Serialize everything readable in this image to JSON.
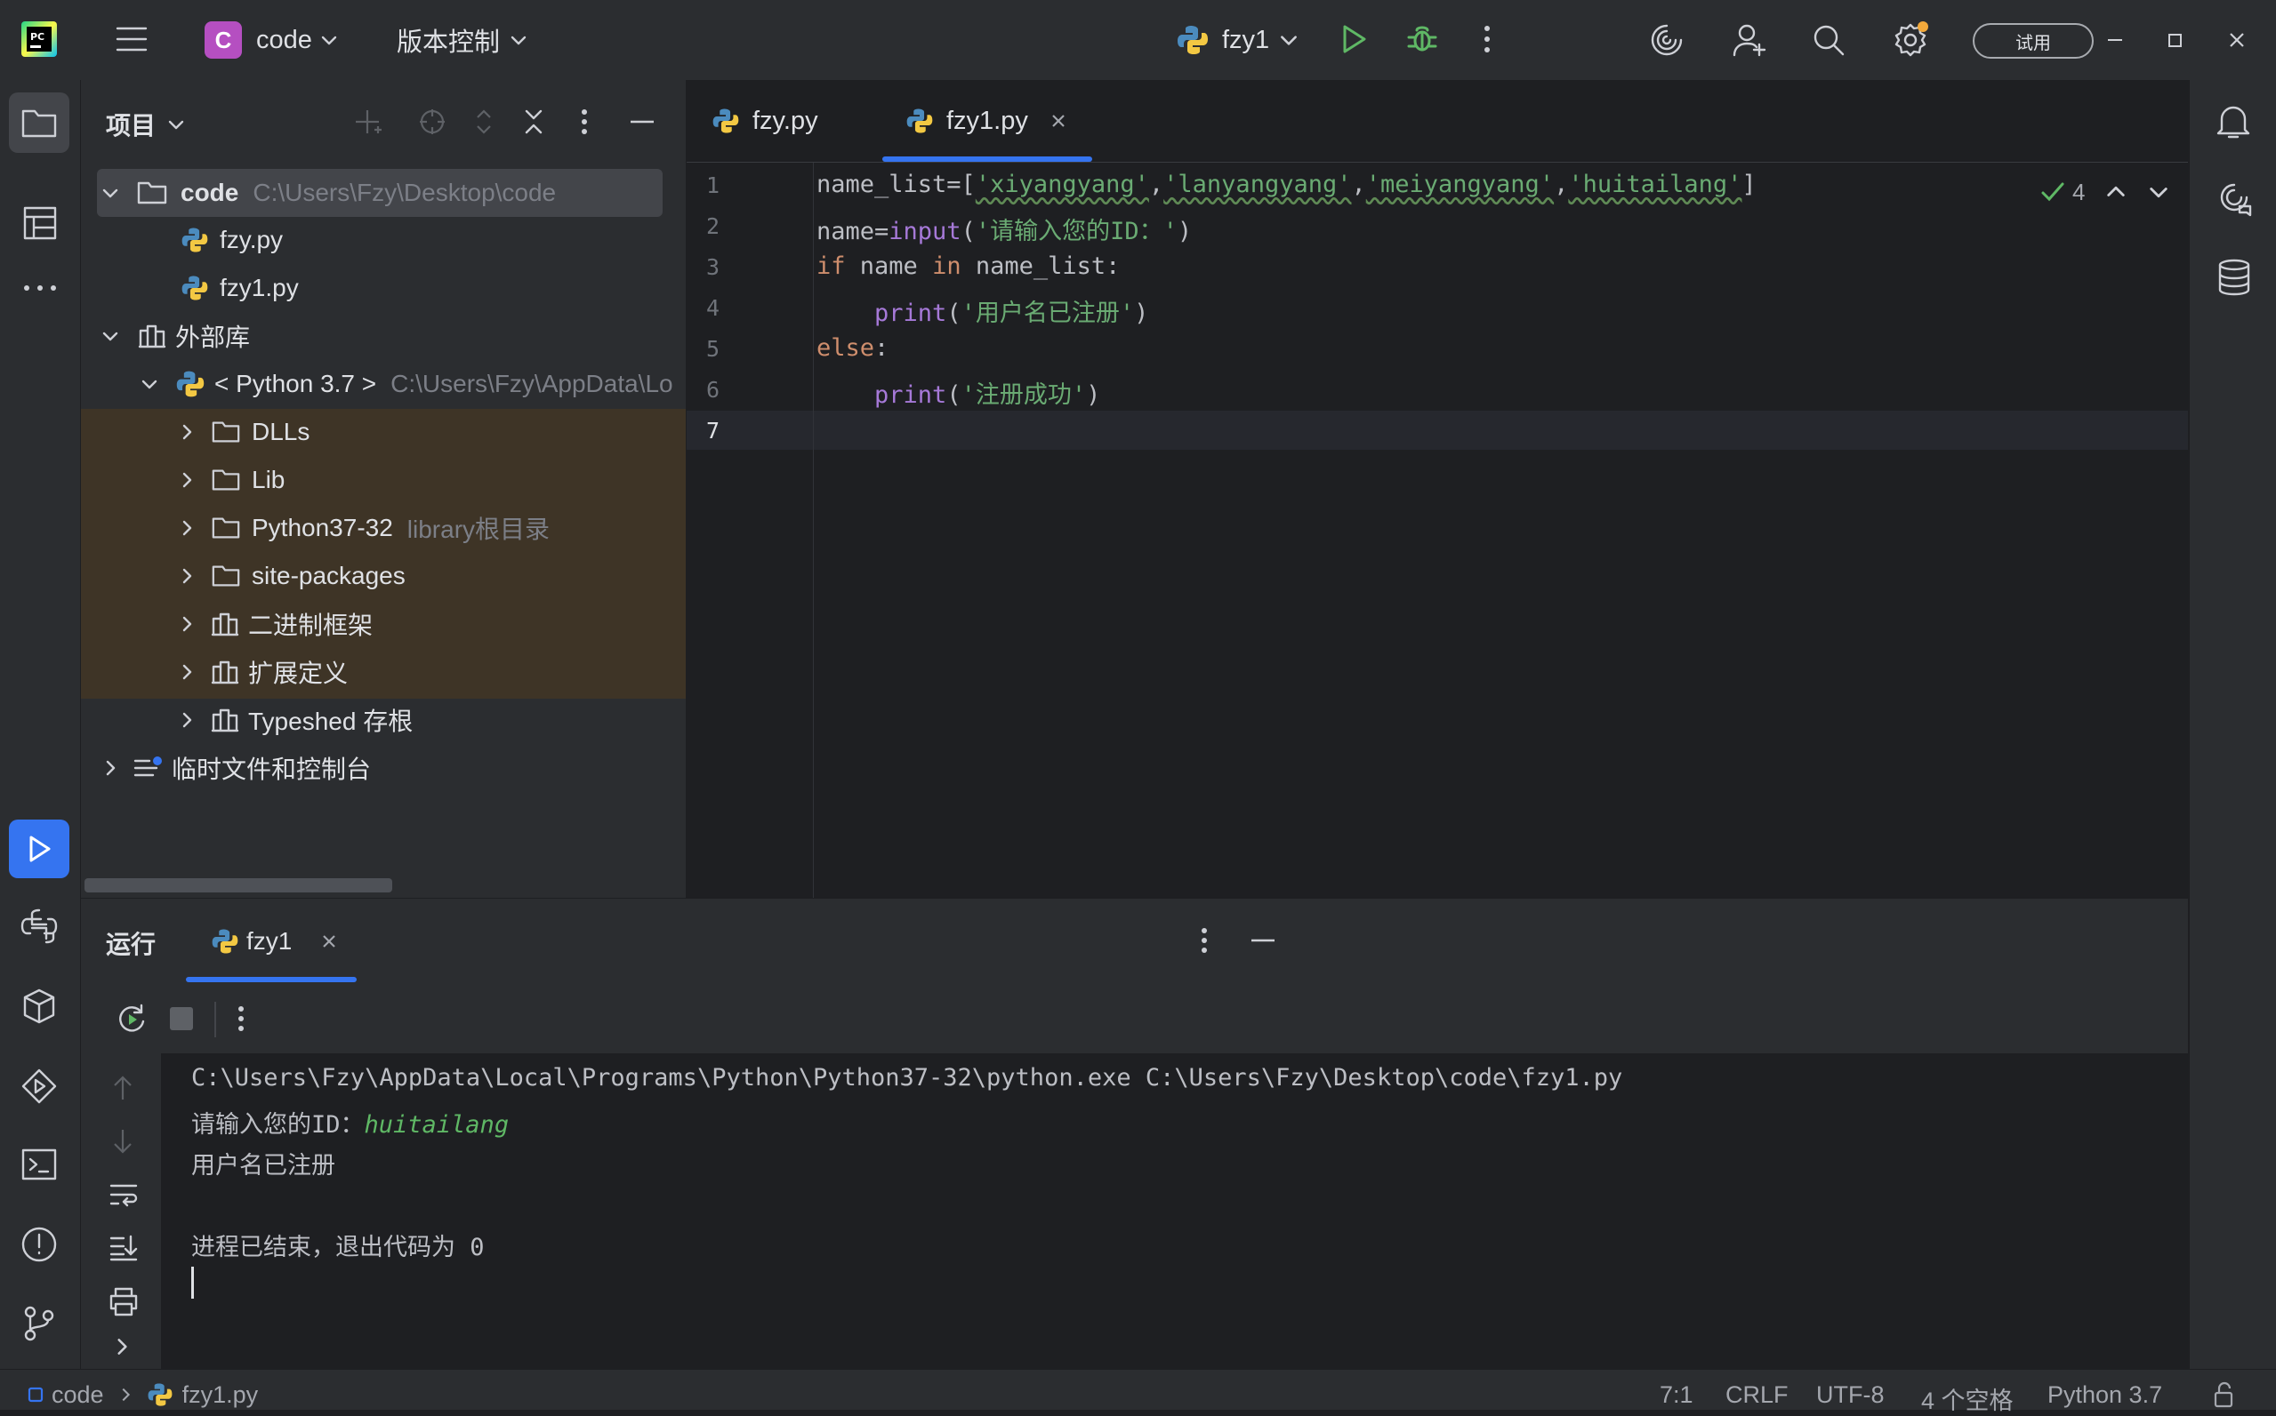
{
  "titlebar": {
    "project_letter": "C",
    "project_name": "code",
    "vcs_label": "版本控制",
    "run_config": "fzy1",
    "trial_label": "试用"
  },
  "project_panel": {
    "title": "项目",
    "root": {
      "name": "code",
      "path": "C:\\Users\\Fzy\\Desktop\\code"
    },
    "files": [
      "fzy.py",
      "fzy1.py"
    ],
    "external_libs": "外部库",
    "python_sdk": {
      "name": "< Python 3.7 >",
      "path": "C:\\Users\\Fzy\\AppData\\Lo"
    },
    "sdk_children": [
      {
        "name": "DLLs",
        "hint": ""
      },
      {
        "name": "Lib",
        "hint": ""
      },
      {
        "name": "Python37-32",
        "hint": "library根目录"
      },
      {
        "name": "site-packages",
        "hint": ""
      },
      {
        "name": "二进制框架",
        "hint": ""
      },
      {
        "name": "扩展定义",
        "hint": ""
      },
      {
        "name": "Typeshed 存根",
        "hint": ""
      }
    ],
    "scratches": "临时文件和控制台"
  },
  "editor": {
    "tabs": [
      {
        "label": "fzy.py",
        "active": false
      },
      {
        "label": "fzy1.py",
        "active": true
      }
    ],
    "inspection_count": "4",
    "line_numbers": [
      "1",
      "2",
      "3",
      "4",
      "5",
      "6",
      "7"
    ],
    "code": {
      "l1": {
        "a": "name_list=[",
        "s1": "'xiyangyang'",
        "s2": "'lanyangyang'",
        "s3": "'meiyangyang'",
        "s4": "'huitailang'",
        "end": "]"
      },
      "l2": {
        "a": "name=",
        "fn": "input",
        "p": "(",
        "s": "'请输入您的ID：'",
        "end": ")"
      },
      "l3": {
        "kw": "if",
        "a": " name ",
        "kw2": "in",
        "b": " name_list:"
      },
      "l4": {
        "indent": "    ",
        "fn": "print",
        "p": "(",
        "s": "'用户名已注册'",
        "end": ")"
      },
      "l5": {
        "kw": "else",
        "end": ":"
      },
      "l6": {
        "indent": "    ",
        "fn": "print",
        "p": "(",
        "s": "'注册成功'",
        "end": ")"
      }
    }
  },
  "run_panel": {
    "title": "运行",
    "tab": "fzy1",
    "console": {
      "command": "C:\\Users\\Fzy\\AppData\\Local\\Programs\\Python\\Python37-32\\python.exe C:\\Users\\Fzy\\Desktop\\code\\fzy1.py",
      "prompt": "请输入您的ID：",
      "input_value": "huitailang",
      "output": "用户名已注册",
      "exit_message": "进程已结束，退出代码为 0"
    }
  },
  "status_bar": {
    "breadcrumb_project": "code",
    "breadcrumb_file": "fzy1.py",
    "cursor": "7:1",
    "line_sep": "CRLF",
    "encoding": "UTF-8",
    "indent": "4 个空格",
    "interpreter": "Python 3.7"
  },
  "colors": {
    "accent": "#3574f0",
    "keyword": "#cf8e6d",
    "string": "#6aab73",
    "function": "#a679d8",
    "excluded_bg": "#3e3426"
  }
}
